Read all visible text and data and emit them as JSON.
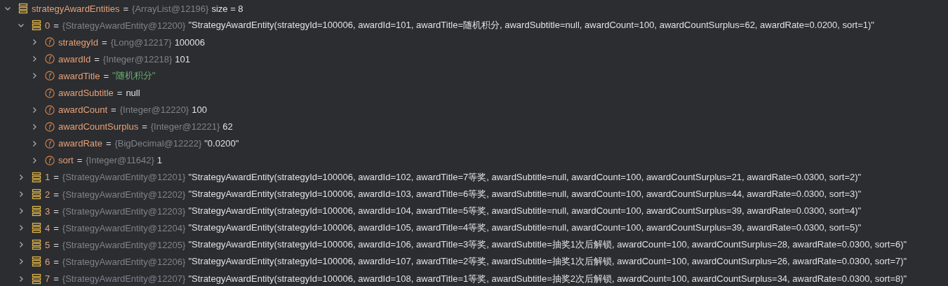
{
  "tree": [
    {
      "kind": "list",
      "name": "strategyAwardEntities",
      "eq": "=",
      "type": "{ArrayList@12196}",
      "value": "size = 8",
      "expanded": true,
      "children": [
        {
          "kind": "list",
          "name": "0",
          "eq": "=",
          "type": "{StrategyAwardEntity@12200}",
          "value": "\"StrategyAwardEntity(strategyId=100006, awardId=101, awardTitle=随机积分, awardSubtitle=null, awardCount=100, awardCountSurplus=62, awardRate=0.0200, sort=1)\"",
          "expanded": true,
          "children": [
            {
              "kind": "field",
              "icon_glyph": "f",
              "name": "strategyId",
              "eq": "=",
              "type": "{Long@12217}",
              "value": "100006",
              "expanded": false
            },
            {
              "kind": "field",
              "icon_glyph": "f",
              "name": "awardId",
              "eq": "=",
              "type": "{Integer@12218}",
              "value": "101",
              "expanded": false
            },
            {
              "kind": "string_field",
              "icon_glyph": "f",
              "name": "awardTitle",
              "eq": "=",
              "value": "\"随机积分\"",
              "expanded": false
            },
            {
              "kind": "field",
              "icon_glyph": "f",
              "name": "awardSubtitle",
              "eq": "=",
              "value": "null"
            },
            {
              "kind": "field",
              "icon_glyph": "f",
              "name": "awardCount",
              "eq": "=",
              "type": "{Integer@12220}",
              "value": "100",
              "expanded": false
            },
            {
              "kind": "field",
              "icon_glyph": "f",
              "name": "awardCountSurplus",
              "eq": "=",
              "type": "{Integer@12221}",
              "value": "62",
              "expanded": false
            },
            {
              "kind": "field",
              "icon_glyph": "f",
              "name": "awardRate",
              "eq": "=",
              "type": "{BigDecimal@12222}",
              "value": "\"0.0200\"",
              "expanded": false
            },
            {
              "kind": "field",
              "icon_glyph": "f",
              "name": "sort",
              "eq": "=",
              "type": "{Integer@11642}",
              "value": "1",
              "expanded": false
            }
          ]
        },
        {
          "kind": "list",
          "name": "1",
          "eq": "=",
          "type": "{StrategyAwardEntity@12201}",
          "value": "\"StrategyAwardEntity(strategyId=100006, awardId=102, awardTitle=7等奖, awardSubtitle=null, awardCount=100, awardCountSurplus=21, awardRate=0.0300, sort=2)\"",
          "expanded": false
        },
        {
          "kind": "list",
          "name": "2",
          "eq": "=",
          "type": "{StrategyAwardEntity@12202}",
          "value": "\"StrategyAwardEntity(strategyId=100006, awardId=103, awardTitle=6等奖, awardSubtitle=null, awardCount=100, awardCountSurplus=44, awardRate=0.0300, sort=3)\"",
          "expanded": false
        },
        {
          "kind": "list",
          "name": "3",
          "eq": "=",
          "type": "{StrategyAwardEntity@12203}",
          "value": "\"StrategyAwardEntity(strategyId=100006, awardId=104, awardTitle=5等奖, awardSubtitle=null, awardCount=100, awardCountSurplus=39, awardRate=0.0300, sort=4)\"",
          "expanded": false
        },
        {
          "kind": "list",
          "name": "4",
          "eq": "=",
          "type": "{StrategyAwardEntity@12204}",
          "value": "\"StrategyAwardEntity(strategyId=100006, awardId=105, awardTitle=4等奖, awardSubtitle=null, awardCount=100, awardCountSurplus=39, awardRate=0.0300, sort=5)\"",
          "expanded": false
        },
        {
          "kind": "list",
          "name": "5",
          "eq": "=",
          "type": "{StrategyAwardEntity@12205}",
          "value": "\"StrategyAwardEntity(strategyId=100006, awardId=106, awardTitle=3等奖, awardSubtitle=抽奖1次后解锁, awardCount=100, awardCountSurplus=28, awardRate=0.0300, sort=6)\"",
          "expanded": false
        },
        {
          "kind": "list",
          "name": "6",
          "eq": "=",
          "type": "{StrategyAwardEntity@12206}",
          "value": "\"StrategyAwardEntity(strategyId=100006, awardId=107, awardTitle=2等奖, awardSubtitle=抽奖1次后解锁, awardCount=100, awardCountSurplus=26, awardRate=0.0300, sort=7)\"",
          "expanded": false
        },
        {
          "kind": "list",
          "name": "7",
          "eq": "=",
          "type": "{StrategyAwardEntity@12207}",
          "value": "\"StrategyAwardEntity(strategyId=100006, awardId=108, awardTitle=1等奖, awardSubtitle=抽奖2次后解锁, awardCount=100, awardCountSurplus=34, awardRate=0.0300, sort=8)\"",
          "expanded": false
        }
      ]
    }
  ]
}
